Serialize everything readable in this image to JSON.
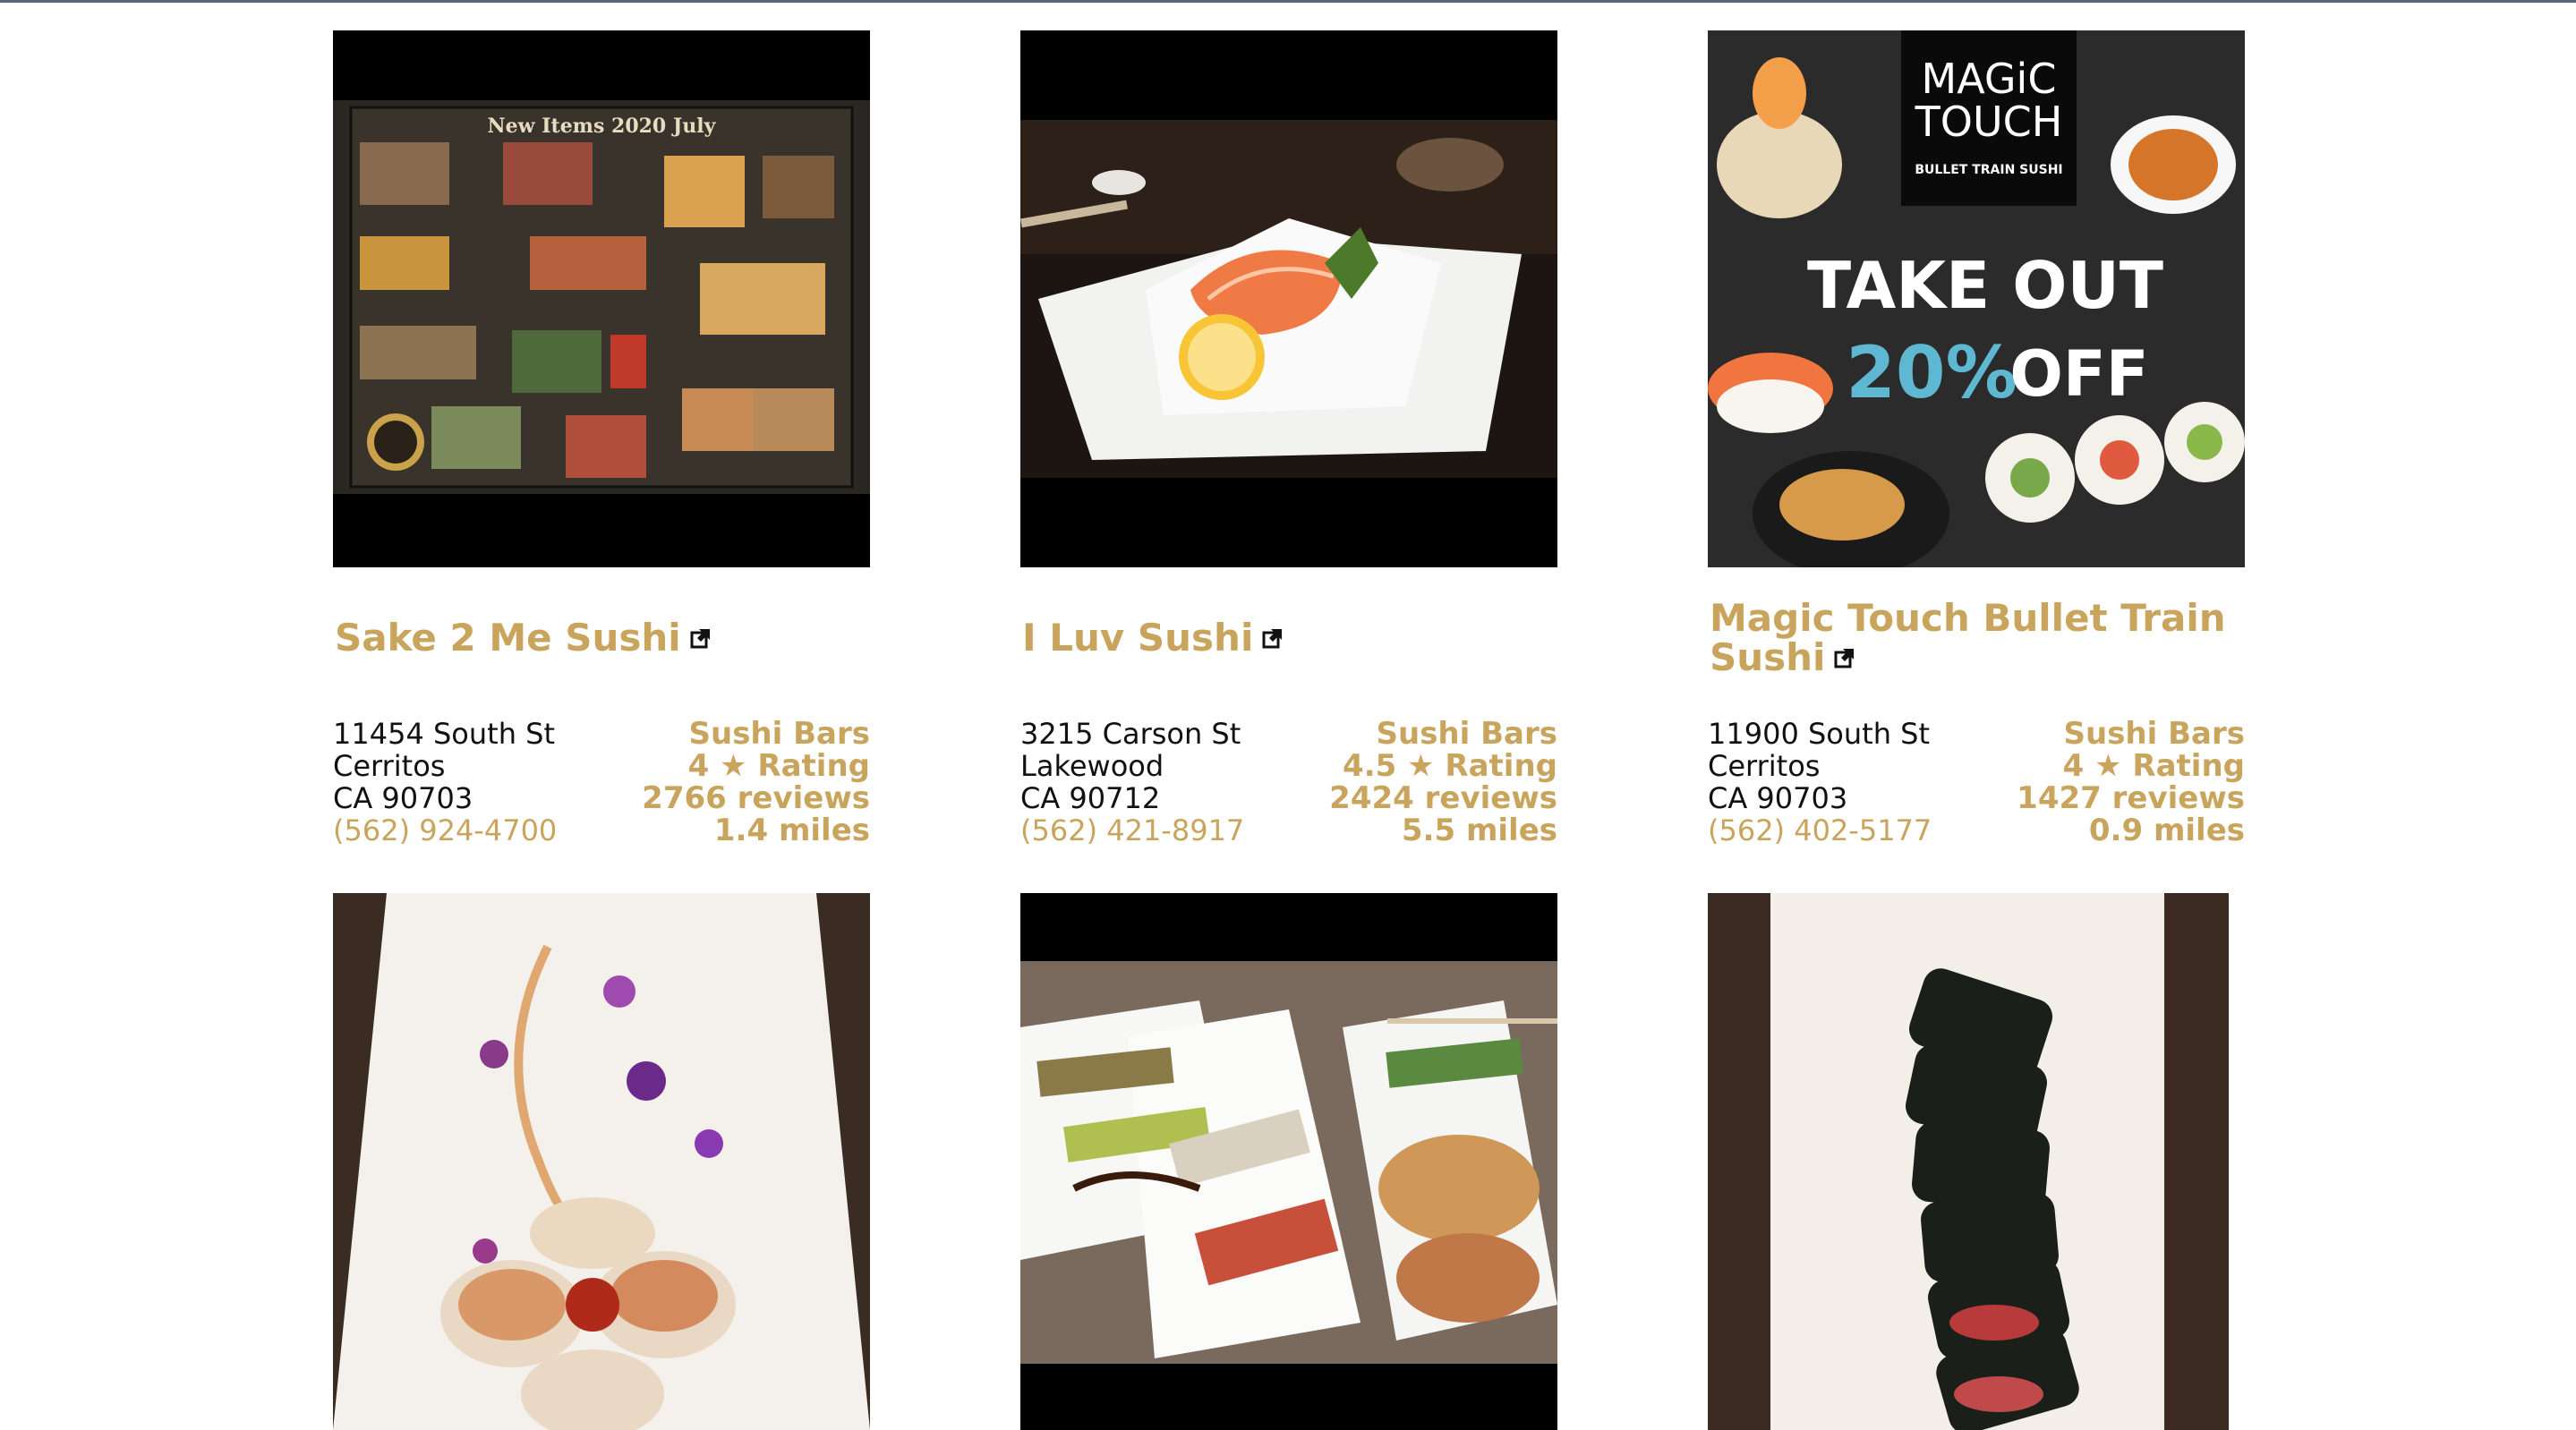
{
  "colors": {
    "accent": "#c9a45c",
    "text": "#111111",
    "topline": "#55657a"
  },
  "cards": [
    {
      "name": "Sake 2 Me Sushi",
      "street": "11454 South St",
      "city": "Cerritos",
      "statezip": "CA 90703",
      "phone": "(562) 924-4700",
      "category": "Sushi Bars",
      "rating": "4 ★ Rating",
      "reviews": "2766 reviews",
      "distance": "1.4 miles",
      "image_icon": "menu-photo",
      "image_text": "New Items 2020 July"
    },
    {
      "name": "I Luv Sushi",
      "street": "3215 Carson St",
      "city": "Lakewood",
      "statezip": "CA 90712",
      "phone": "(562) 421-8917",
      "category": "Sushi Bars",
      "rating": "4.5 ★ Rating",
      "reviews": "2424 reviews",
      "distance": "5.5 miles",
      "image_icon": "sashimi-photo"
    },
    {
      "name": "Magic Touch Bullet Train Sushi",
      "name_line1": "Magic Touch Bullet Train",
      "name_line2": "Sushi",
      "street": "11900 South St",
      "city": "Cerritos",
      "statezip": "CA 90703",
      "phone": "(562) 402-5177",
      "category": "Sushi Bars",
      "rating": "4 ★ Rating",
      "reviews": "1427 reviews",
      "distance": "0.9 miles",
      "image_icon": "promo-photo",
      "image_text": {
        "logo_line1": "MAGiC",
        "logo_line2": "TOUCH",
        "logo_sub": "BULLET TRAIN SUSHI",
        "promo_line1": "TAKE OUT",
        "promo_pct": "20%",
        "promo_off": "OFF"
      }
    },
    {
      "image_icon": "sushi-plate-photo"
    },
    {
      "image_icon": "sushi-rolls-table-photo"
    },
    {
      "image_icon": "nori-roll-photo"
    }
  ]
}
